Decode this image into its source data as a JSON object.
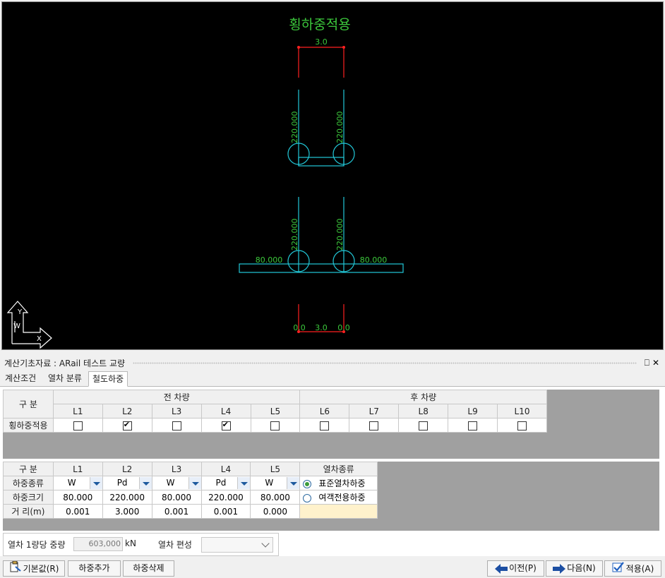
{
  "drawing": {
    "title": "횡하중적용",
    "top_dim": "3.0",
    "upper_left_load": "220.000",
    "upper_right_load": "220.000",
    "lower_left_load": "220.000",
    "lower_right_load": "220.000",
    "left_side_load": "80.000",
    "right_side_load": "80.000",
    "bottom_left": "0.0",
    "bottom_mid": "3.0",
    "bottom_right": "0.0",
    "axis_y": "Y",
    "axis_w": "W",
    "axis_x": "X",
    "colors": {
      "title": "#3cc83c",
      "dim_line": "#ff2020",
      "geometry": "#22c8d8",
      "labels": "#3cc83c"
    }
  },
  "panel": {
    "title": "계산기초자료 : ARail 테스트 교량",
    "pin": "⎕",
    "close": "✕"
  },
  "tabs": [
    "계산조건",
    "열차 분류",
    "철도하중"
  ],
  "active_tab": 2,
  "table1": {
    "corner": "구  분",
    "group_front": "전 차량",
    "group_rear": "후 차량",
    "columns": [
      "L1",
      "L2",
      "L3",
      "L4",
      "L5",
      "L6",
      "L7",
      "L8",
      "L9",
      "L10"
    ],
    "row_label": "횡하중적용",
    "checked": [
      false,
      true,
      false,
      true,
      false,
      false,
      false,
      false,
      false,
      false
    ]
  },
  "table2": {
    "corner": "구  분",
    "columns": [
      "L1",
      "L2",
      "L3",
      "L4",
      "L5"
    ],
    "type_header": "열차종류",
    "rows": {
      "type": {
        "label": "하중종류",
        "values": [
          "W",
          "Pd",
          "W",
          "Pd",
          "W"
        ]
      },
      "size": {
        "label": "하중크기",
        "values": [
          "80.000",
          "220.000",
          "80.000",
          "220.000",
          "80.000"
        ]
      },
      "dist": {
        "label": "거 리(m)",
        "values": [
          "0.001",
          "3.000",
          "0.001",
          "0.001",
          "0.000"
        ]
      }
    },
    "radio_options": [
      "표준열차하중",
      "여객전용하중"
    ],
    "radio_selected": 0
  },
  "bottom": {
    "weight_label": "열차 1량당 중량",
    "weight_value": "603,000",
    "weight_unit": "kN",
    "composition_label": "열차 편성",
    "composition_value": ""
  },
  "buttons": {
    "default": "기본값(R)",
    "add_load": "하중추가",
    "delete_load": "하중삭제",
    "prev": "이전(P)",
    "next": "다음(N)",
    "apply": "적용(A)"
  }
}
